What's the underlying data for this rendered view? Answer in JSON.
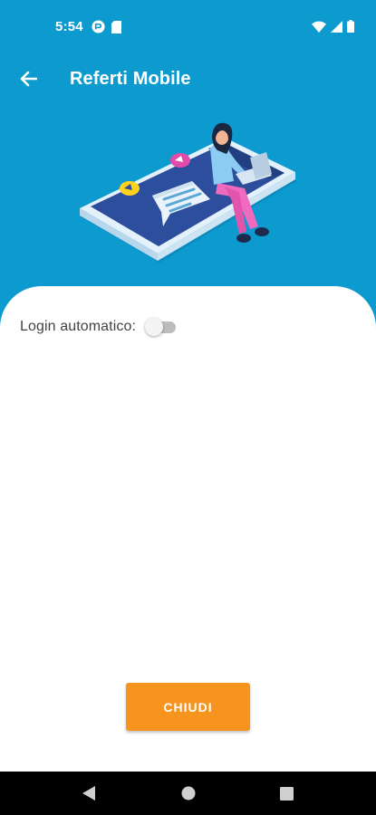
{
  "status_bar": {
    "time": "5:54",
    "left_icons": [
      "sync-icon",
      "sim-card-icon"
    ],
    "right_icons": [
      "wifi-icon",
      "signal-icon",
      "battery-icon"
    ]
  },
  "app_bar": {
    "title": "Referti Mobile",
    "back_icon": "arrow-left-icon"
  },
  "hero": {
    "illustration": "woman-with-laptop-on-phone-illustration"
  },
  "settings": {
    "auto_login_label": "Login automatico:",
    "auto_login_enabled": false
  },
  "actions": {
    "close_label": "CHIUDI"
  },
  "nav_bar": {
    "icons": [
      "back-triangle-icon",
      "home-circle-icon",
      "recents-square-icon"
    ]
  },
  "colors": {
    "primary": "#0d9bcf",
    "accent": "#f7941d",
    "surface": "#ffffff"
  }
}
